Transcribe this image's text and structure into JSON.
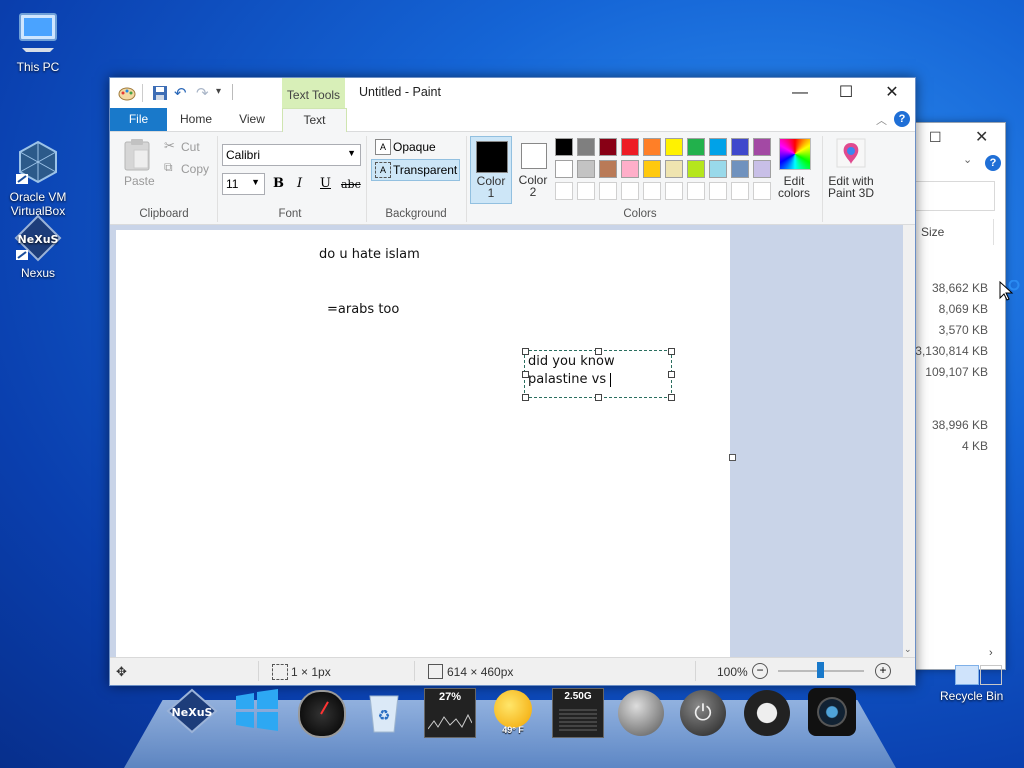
{
  "desktop": {
    "icons": [
      {
        "label": "This PC"
      },
      {
        "label": "Oracle VM\nVirtualBox"
      },
      {
        "label": "Nexus"
      }
    ],
    "recycle_bin_label": "Recycle Bin"
  },
  "explorer": {
    "column_size": "Size",
    "sizes": [
      "38,662 KB",
      "8,069 KB",
      "3,570 KB",
      "3,130,814 KB",
      "109,107 KB",
      "38,996 KB",
      "4 KB"
    ]
  },
  "paint": {
    "window_title": "Untitled - Paint",
    "contextual_tab": "Text Tools",
    "tabs": {
      "file": "File",
      "home": "Home",
      "view": "View",
      "text": "Text"
    },
    "clipboard": {
      "paste": "Paste",
      "cut": "Cut",
      "copy": "Copy",
      "label": "Clipboard"
    },
    "font": {
      "family": "Calibri",
      "size": "11",
      "label": "Font"
    },
    "background": {
      "opaque": "Opaque",
      "transparent": "Transparent",
      "label": "Background"
    },
    "colors": {
      "color1": "Color\n1",
      "color2": "Color\n2",
      "edit": "Edit\ncolors",
      "label": "Colors",
      "palette_row1": [
        "#000000",
        "#7f7f7f",
        "#880015",
        "#ed1c24",
        "#ff7f27",
        "#fff200",
        "#22b14c",
        "#00a2e8",
        "#3f48cc",
        "#a349a4"
      ],
      "palette_row2": [
        "#ffffff",
        "#c3c3c3",
        "#b97a57",
        "#ffaec9",
        "#ffc90e",
        "#efe4b0",
        "#b5e61d",
        "#99d9ea",
        "#7092be",
        "#c8bfe7"
      ]
    },
    "paint3d": "Edit with\nPaint 3D",
    "canvas_texts": {
      "line1": "do u hate islam",
      "line2": "=arabs too",
      "textbox_line1": "did you know",
      "textbox_line2": "palastine vs "
    },
    "status": {
      "selection": "1 × 1px",
      "image_size": "614 × 460px",
      "zoom": "100%"
    }
  },
  "taskbar": {
    "cpu": "27%",
    "weather": "49° F",
    "mem": "2.50G"
  }
}
